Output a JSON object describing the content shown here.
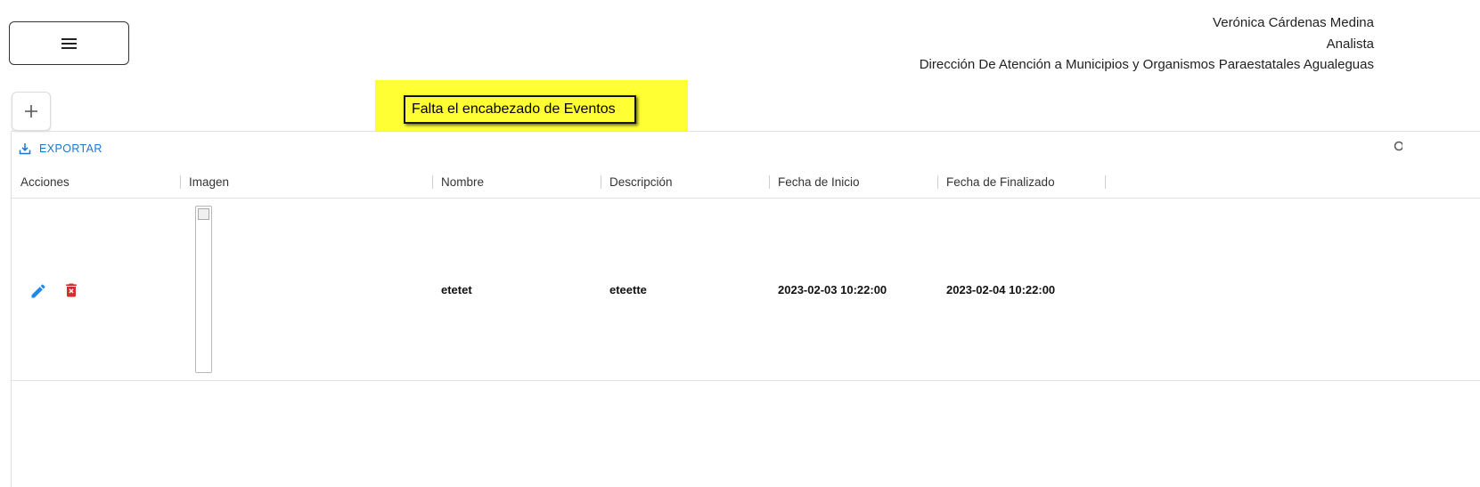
{
  "user": {
    "name": "Verónica Cárdenas Medina",
    "role": "Analista",
    "department": "Dirección De Atención a Municipios y Organismos Paraestatales Agualeguas"
  },
  "note": {
    "text": "Falta el encabezado de Eventos",
    "background": "#ffff33"
  },
  "toolbar": {
    "export_label": "EXPORTAR",
    "accent": "#1976d2"
  },
  "table": {
    "columns": [
      "Acciones",
      "Imagen",
      "Nombre",
      "Descripción",
      "Fecha de Inicio",
      "Fecha de Finalizado"
    ],
    "rows": [
      {
        "actions": [
          "edit-icon",
          "delete-icon"
        ],
        "image": "broken-image",
        "nombre": "etetet",
        "descripcion": "eteette",
        "fecha_inicio": "2023-02-03 10:22:00",
        "fecha_finalizado": "2023-02-04 10:22:00"
      }
    ]
  },
  "icons": {
    "menu": "hamburger-menu-icon",
    "add": "plus-icon",
    "export": "download-icon",
    "edit": "pencil-icon",
    "delete": "trash-icon",
    "edit_color": "#1e88e5",
    "delete_color": "#d32f2f"
  }
}
